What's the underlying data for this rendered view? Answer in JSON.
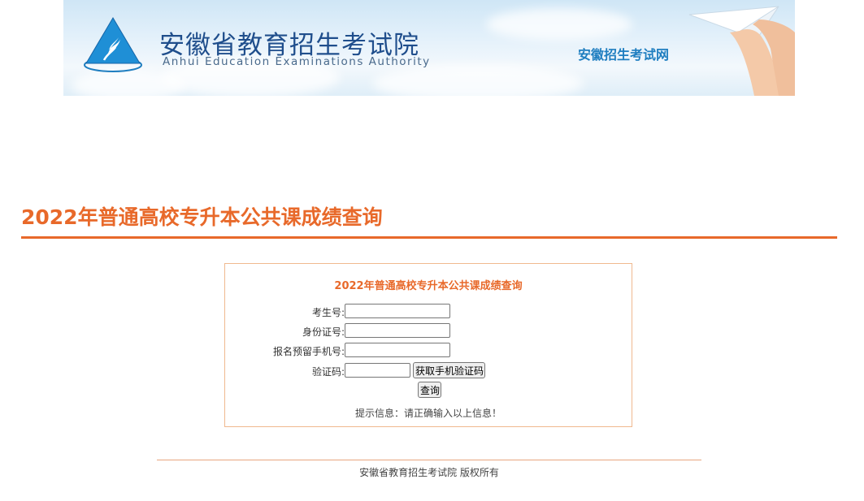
{
  "banner": {
    "title": "安徽省教育招生考试院",
    "subtitle": "Anhui Education Examinations Authority",
    "right_text": "安徽招生考试网"
  },
  "page": {
    "title": "2022年普通高校专升本公共课成绩查询"
  },
  "form": {
    "title": "2022年普通高校专升本公共课成绩查询",
    "exam_no_label": "考生号:",
    "exam_no_value": "",
    "id_label": "身份证号:",
    "id_value": "",
    "phone_label": "报名预留手机号:",
    "phone_value": "",
    "code_label": "验证码:",
    "code_value": "",
    "get_code_button": "获取手机验证码",
    "query_button": "查询",
    "hint": "提示信息：请正确输入以上信息！"
  },
  "footer": {
    "text": "安徽省教育招生考试院 版权所有"
  },
  "colors": {
    "accent": "#e8692a",
    "brand_blue": "#1f4e8c",
    "banner_link": "#1f7ec0"
  }
}
